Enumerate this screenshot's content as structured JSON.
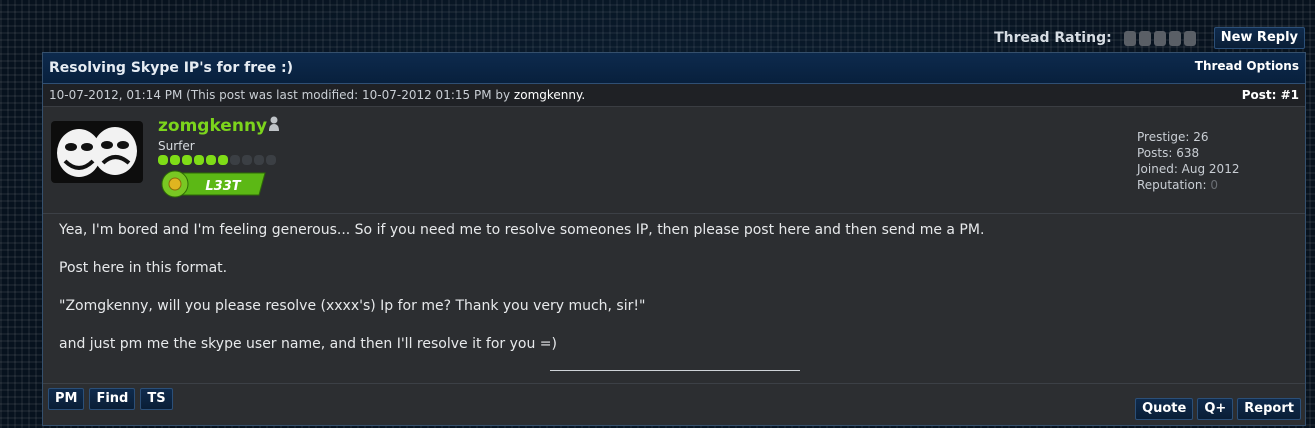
{
  "header": {
    "rating_label": "Thread Rating:",
    "star_count": 5,
    "new_reply_label": "New Reply"
  },
  "thread": {
    "title": "Resolving Skype IP's for free :)",
    "options_label": "Thread Options"
  },
  "post": {
    "date_text": "10-07-2012, 01:14 PM (This post was last modified: 10-07-2012 01:15 PM by",
    "modified_by": "zomgkenny.",
    "number_label": "Post: #1",
    "author": {
      "username": "zomgkenny",
      "usertitle": "Surfer",
      "rep_level_filled": 6,
      "rep_level_total": 10,
      "badge_text": "L33T",
      "colors": {
        "username": "#7cd51c",
        "badge": "#6fc41d"
      }
    },
    "stats": {
      "prestige": "Prestige: 26",
      "posts": "Posts: 638",
      "joined": "Joined: Aug 2012",
      "reputation_label": "Reputation:",
      "reputation_value": "0"
    },
    "body": [
      "Yea, I'm bored and I'm feeling generous... So if you need me to resolve someones IP, then please post here and then send me a PM.",
      "Post here in this format.",
      "\"Zomgkenny, will you please resolve (xxxx's) Ip for me? Thank you very much, sir!\"",
      "and just pm me the skype user name, and then I'll resolve it for you =)"
    ],
    "footer": {
      "left_buttons": [
        "PM",
        "Find",
        "TS"
      ],
      "right_buttons": [
        "Quote",
        "Q+",
        "Report"
      ]
    }
  }
}
